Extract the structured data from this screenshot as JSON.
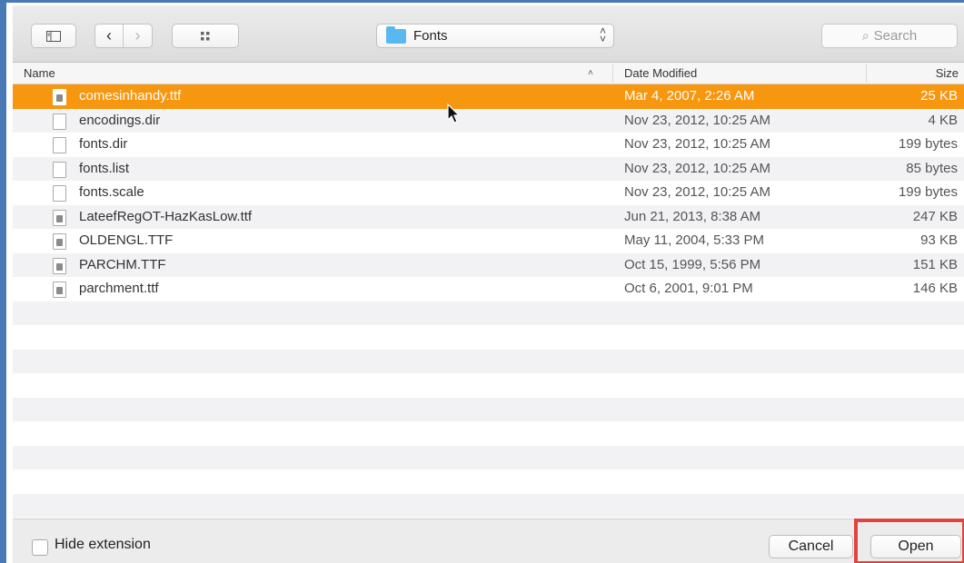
{
  "toolbar": {
    "path_label": "Fonts",
    "search_placeholder": "Search"
  },
  "columns": {
    "name": "Name",
    "date": "Date Modified",
    "size": "Size"
  },
  "files": [
    {
      "name": "comesinhandy.ttf",
      "date": "Mar 4, 2007, 2:26 AM",
      "size": "25 KB",
      "icon": "font-file-icon",
      "selected": true
    },
    {
      "name": "encodings.dir",
      "date": "Nov 23, 2012, 10:25 AM",
      "size": "4 KB",
      "icon": "document-icon"
    },
    {
      "name": "fonts.dir",
      "date": "Nov 23, 2012, 10:25 AM",
      "size": "199 bytes",
      "icon": "document-icon"
    },
    {
      "name": "fonts.list",
      "date": "Nov 23, 2012, 10:25 AM",
      "size": "85 bytes",
      "icon": "document-icon"
    },
    {
      "name": "fonts.scale",
      "date": "Nov 23, 2012, 10:25 AM",
      "size": "199 bytes",
      "icon": "document-icon"
    },
    {
      "name": "LateefRegOT-HazKasLow.ttf",
      "date": "Jun 21, 2013, 8:38 AM",
      "size": "247 KB",
      "icon": "font-file-icon"
    },
    {
      "name": "OLDENGL.TTF",
      "date": "May 11, 2004, 5:33 PM",
      "size": "93 KB",
      "icon": "font-file-icon"
    },
    {
      "name": "PARCHM.TTF",
      "date": "Oct 15, 1999, 5:56 PM",
      "size": "151 KB",
      "icon": "font-file-icon"
    },
    {
      "name": "parchment.ttf",
      "date": "Oct 6, 2001, 9:01 PM",
      "size": "146 KB",
      "icon": "font-file-icon"
    }
  ],
  "footer": {
    "hide_extension_label": "Hide extension",
    "cancel_label": "Cancel",
    "open_label": "Open"
  },
  "colors": {
    "selection": "#f7960f",
    "highlight": "#e1443c",
    "folder": "#58b8ef"
  }
}
